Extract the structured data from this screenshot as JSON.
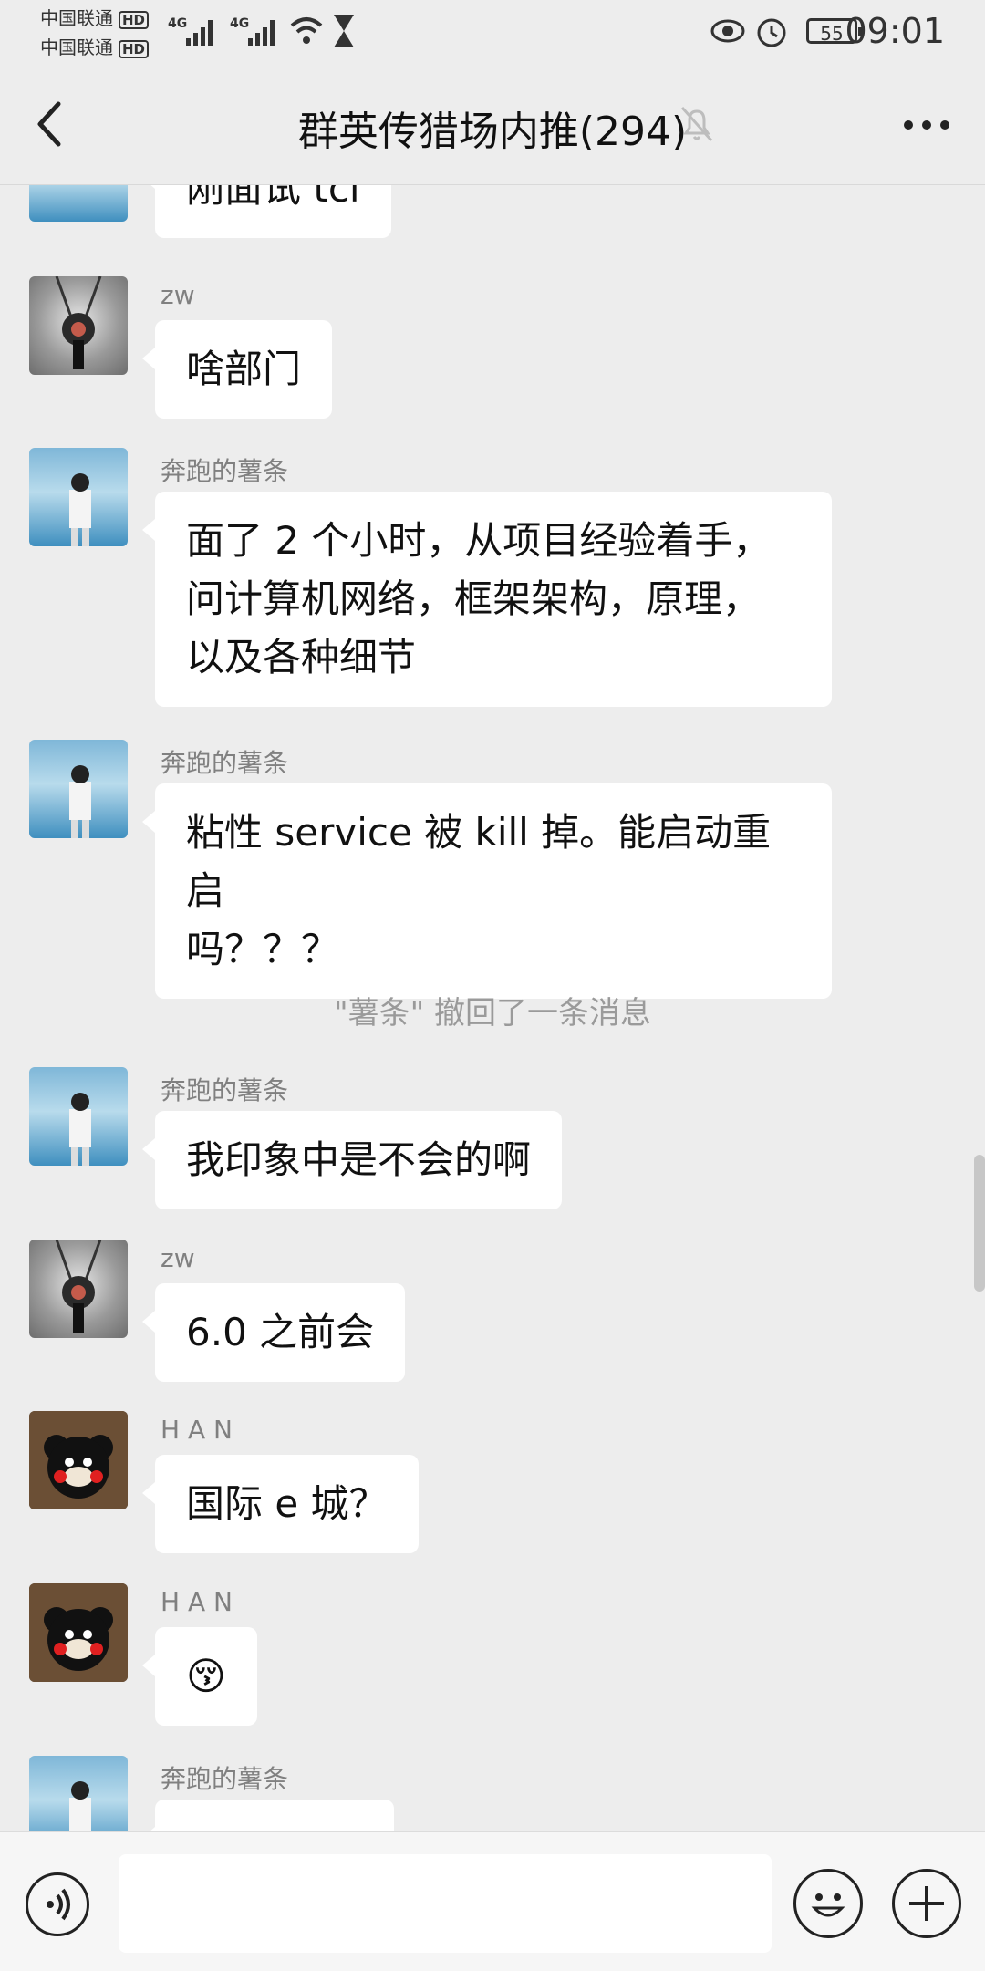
{
  "status_bar": {
    "carrier1": "中国联通",
    "carrier2": "中国联通",
    "hd": "HD",
    "network": "4G",
    "battery": "55",
    "time": "09:01"
  },
  "header": {
    "title": "群英传猎场内推(294)"
  },
  "messages": [
    {
      "sender": "",
      "text": "刚面试 tcl"
    },
    {
      "sender": "zw",
      "text": "啥部门"
    },
    {
      "sender": "奔跑的薯条",
      "lines": [
        "面了 2 个小时，从项目经验着手，",
        "问计算机网络，框架架构，原理，",
        "以及各种细节"
      ]
    },
    {
      "sender": "奔跑的薯条",
      "lines": [
        "粘性 service 被 kill 掉。能启动重启",
        "吗？？？"
      ]
    },
    {
      "sender": "奔跑的薯条",
      "text": "我印象中是不会的啊"
    },
    {
      "sender": "zw",
      "text": "6.0 之前会"
    },
    {
      "sender": "H A N",
      "text": "国际 e 城？"
    },
    {
      "sender": "H A N",
      "text": "😚"
    },
    {
      "sender": "奔跑的薯条",
      "text": ""
    }
  ],
  "system_message": "\"薯条\" 撤回了一条消息",
  "input": {
    "placeholder": ""
  }
}
